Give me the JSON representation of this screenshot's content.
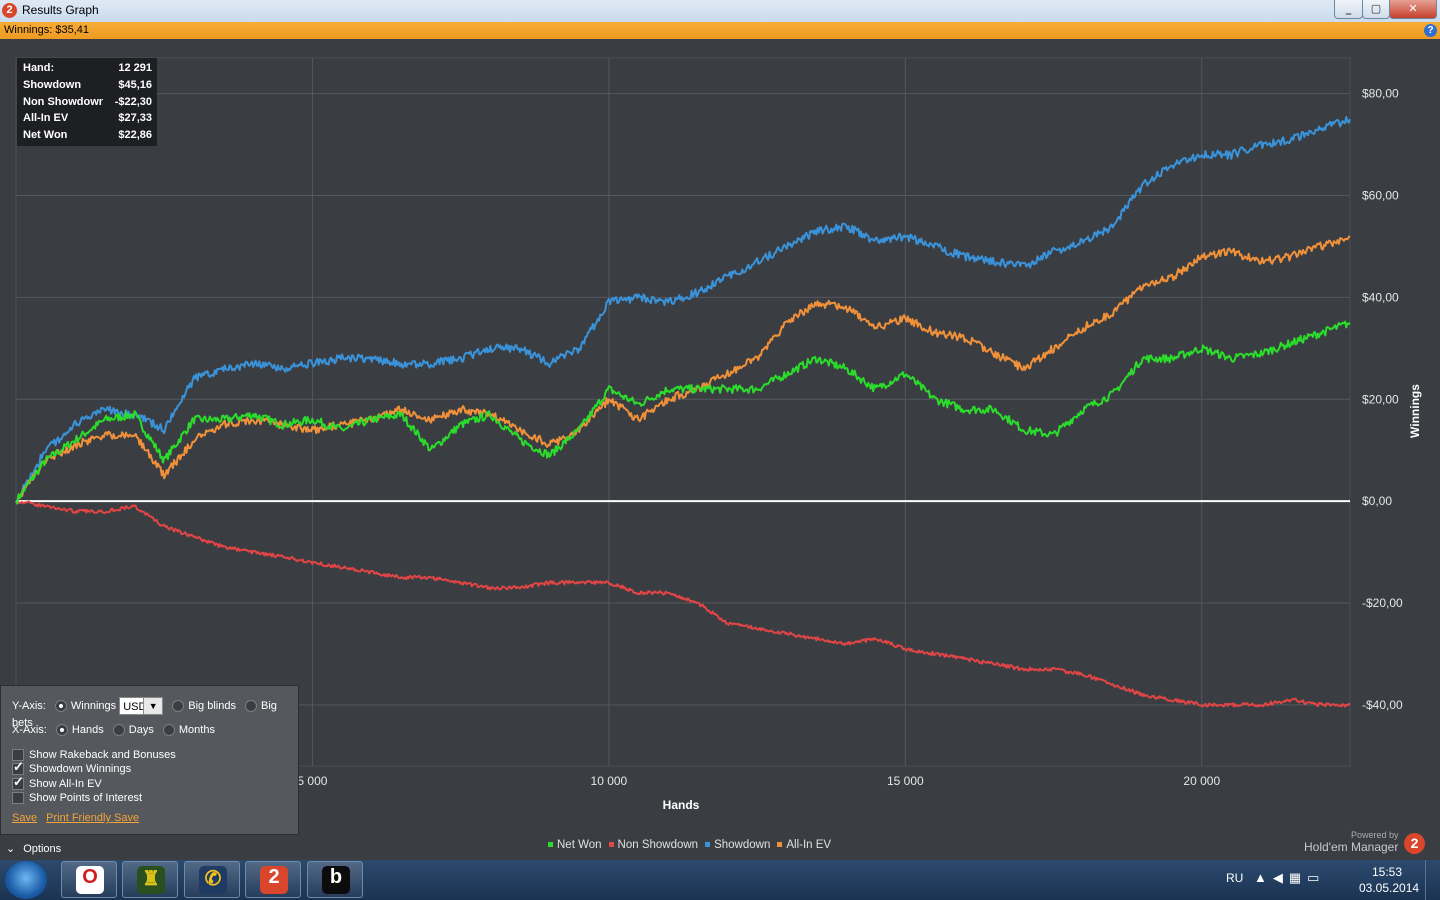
{
  "window": {
    "title": "Results Graph",
    "app_icon": "hem2-logo-icon",
    "winnings_label": "Winnings: $35,41",
    "help_icon": "help-icon"
  },
  "stats": [
    {
      "label": "Hand:",
      "value": "12 291"
    },
    {
      "label": "Showdown",
      "value": "$45,16"
    },
    {
      "label": "Non Showdown",
      "value": "-$22,30"
    },
    {
      "label": "All-In EV",
      "value": "$27,33"
    },
    {
      "label": "Net Won",
      "value": "$22,86"
    }
  ],
  "chart_data": {
    "type": "line",
    "xlabel": "Hands",
    "ylabel": "Winnings",
    "xlim": [
      0,
      22500
    ],
    "ylim": [
      -52,
      87
    ],
    "x_ticks": [
      "5 000",
      "10 000",
      "15 000",
      "20 000"
    ],
    "x_tick_values": [
      5000,
      10000,
      15000,
      20000
    ],
    "y_ticks": [
      "$80,00",
      "$60,00",
      "$40,00",
      "$20,00",
      "$0,00",
      "-$20,00",
      "-$40,00"
    ],
    "y_tick_values": [
      80,
      60,
      40,
      20,
      0,
      -20,
      -40
    ],
    "grid": true,
    "legend_position": "bottom-center",
    "x": [
      0,
      500,
      1000,
      1500,
      2000,
      2500,
      3000,
      3500,
      4000,
      4500,
      5000,
      5500,
      6000,
      6500,
      7000,
      7500,
      8000,
      8500,
      9000,
      9500,
      10000,
      10500,
      11000,
      11500,
      12000,
      12500,
      13000,
      13500,
      14000,
      14500,
      15000,
      15500,
      16000,
      16500,
      17000,
      17500,
      18000,
      18500,
      19000,
      19500,
      20000,
      20500,
      21000,
      21500,
      22000,
      22500
    ],
    "series": [
      {
        "name": "Net Won",
        "color": "#2bdc2b",
        "values": [
          0,
          8,
          12,
          16,
          17,
          8,
          16,
          16,
          17,
          15,
          16,
          14,
          16,
          17,
          10,
          15,
          17,
          12,
          9,
          14,
          22,
          19,
          22,
          22,
          22,
          22,
          25,
          28,
          26,
          22,
          25,
          20,
          18,
          18,
          14,
          13,
          18,
          21,
          28,
          28,
          30,
          28,
          29,
          31,
          33,
          35
        ]
      },
      {
        "name": "Non Showdown",
        "color": "#e24545",
        "values": [
          0,
          -1,
          -2,
          -2,
          -1,
          -5,
          -7,
          -9,
          -10,
          -11,
          -12,
          -13,
          -14,
          -15,
          -15,
          -16,
          -17,
          -17,
          -16,
          -16,
          -16,
          -18,
          -18,
          -20,
          -24,
          -25,
          -26,
          -27,
          -28,
          -27,
          -29,
          -30,
          -31,
          -32,
          -33,
          -33,
          -34,
          -36,
          -38,
          -39,
          -40,
          -40,
          -40,
          -39,
          -40,
          -40
        ]
      },
      {
        "name": "Showdown",
        "color": "#3a93d9",
        "values": [
          0,
          10,
          15,
          18,
          17,
          14,
          24,
          26,
          27,
          26,
          27,
          28,
          28,
          27,
          27,
          28,
          30,
          30,
          27,
          30,
          39,
          40,
          39,
          41,
          44,
          47,
          50,
          53,
          54,
          51,
          52,
          50,
          48,
          47,
          46,
          49,
          51,
          54,
          62,
          66,
          68,
          68,
          70,
          71,
          73,
          75
        ]
      },
      {
        "name": "All-In EV",
        "color": "#f0913a",
        "values": [
          0,
          8,
          11,
          13,
          13,
          5,
          12,
          15,
          16,
          15,
          14,
          15,
          16,
          18,
          16,
          18,
          17,
          14,
          11,
          14,
          20,
          16,
          20,
          22,
          25,
          28,
          35,
          39,
          38,
          34,
          36,
          33,
          32,
          29,
          26,
          30,
          34,
          37,
          42,
          44,
          48,
          49,
          47,
          48,
          50,
          52
        ]
      }
    ]
  },
  "options": {
    "y_axis_label": "Y-Axis:",
    "y_winnings": "Winnings",
    "currency": "USD",
    "y_big_blinds": "Big blinds",
    "y_big_bets": "Big bets",
    "x_axis_label": "X-Axis:",
    "x_hands": "Hands",
    "x_days": "Days",
    "x_months": "Months",
    "cb_rakeback": "Show Rakeback and Bonuses",
    "cb_showdown": "Showdown Winnings",
    "cb_allin": "Show All-In EV",
    "cb_poi": "Show Points of Interest",
    "save": "Save",
    "print_save": "Print Friendly Save",
    "toggle": "Options"
  },
  "branding": {
    "powered_by": "Powered by",
    "name": "Hold'em Manager",
    "logo_text": "2"
  },
  "taskbar": {
    "lang": "RU",
    "time": "15:53",
    "date": "03.05.2014",
    "apps": [
      {
        "name": "opera-icon",
        "glyph": "O",
        "color": "#d01f1f",
        "bg": "#ffffff"
      },
      {
        "name": "game-icon",
        "glyph": "♜",
        "color": "#d8c21a",
        "bg": "#2a4f1e"
      },
      {
        "name": "messenger-icon",
        "glyph": "✆",
        "color": "#f2c21b",
        "bg": "#1f3b63"
      },
      {
        "name": "hem2-icon",
        "glyph": "2",
        "color": "#ffffff",
        "bg": "#d9462c"
      },
      {
        "name": "b-app-icon",
        "glyph": "b",
        "color": "#ffffff",
        "bg": "#0c0c0c"
      }
    ]
  }
}
